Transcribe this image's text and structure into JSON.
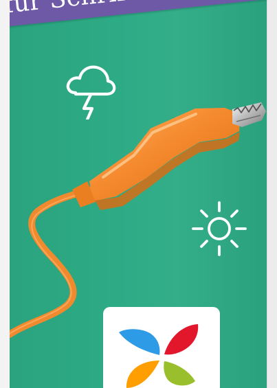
{
  "banner": {
    "text": "für Schrift er"
  },
  "icons": {
    "weather": "storm-cloud-icon",
    "sun": "sun-icon",
    "logo": "butterfly-logo"
  },
  "colors": {
    "background": "#2dab85",
    "banner": "#6d59a6",
    "cable": "#f58a2f",
    "metal_tip": "#d2d2d2",
    "logo_blue": "#2e9be7",
    "logo_red": "#e3172b",
    "logo_orange": "#ff9e00",
    "logo_green": "#99bf2c"
  }
}
